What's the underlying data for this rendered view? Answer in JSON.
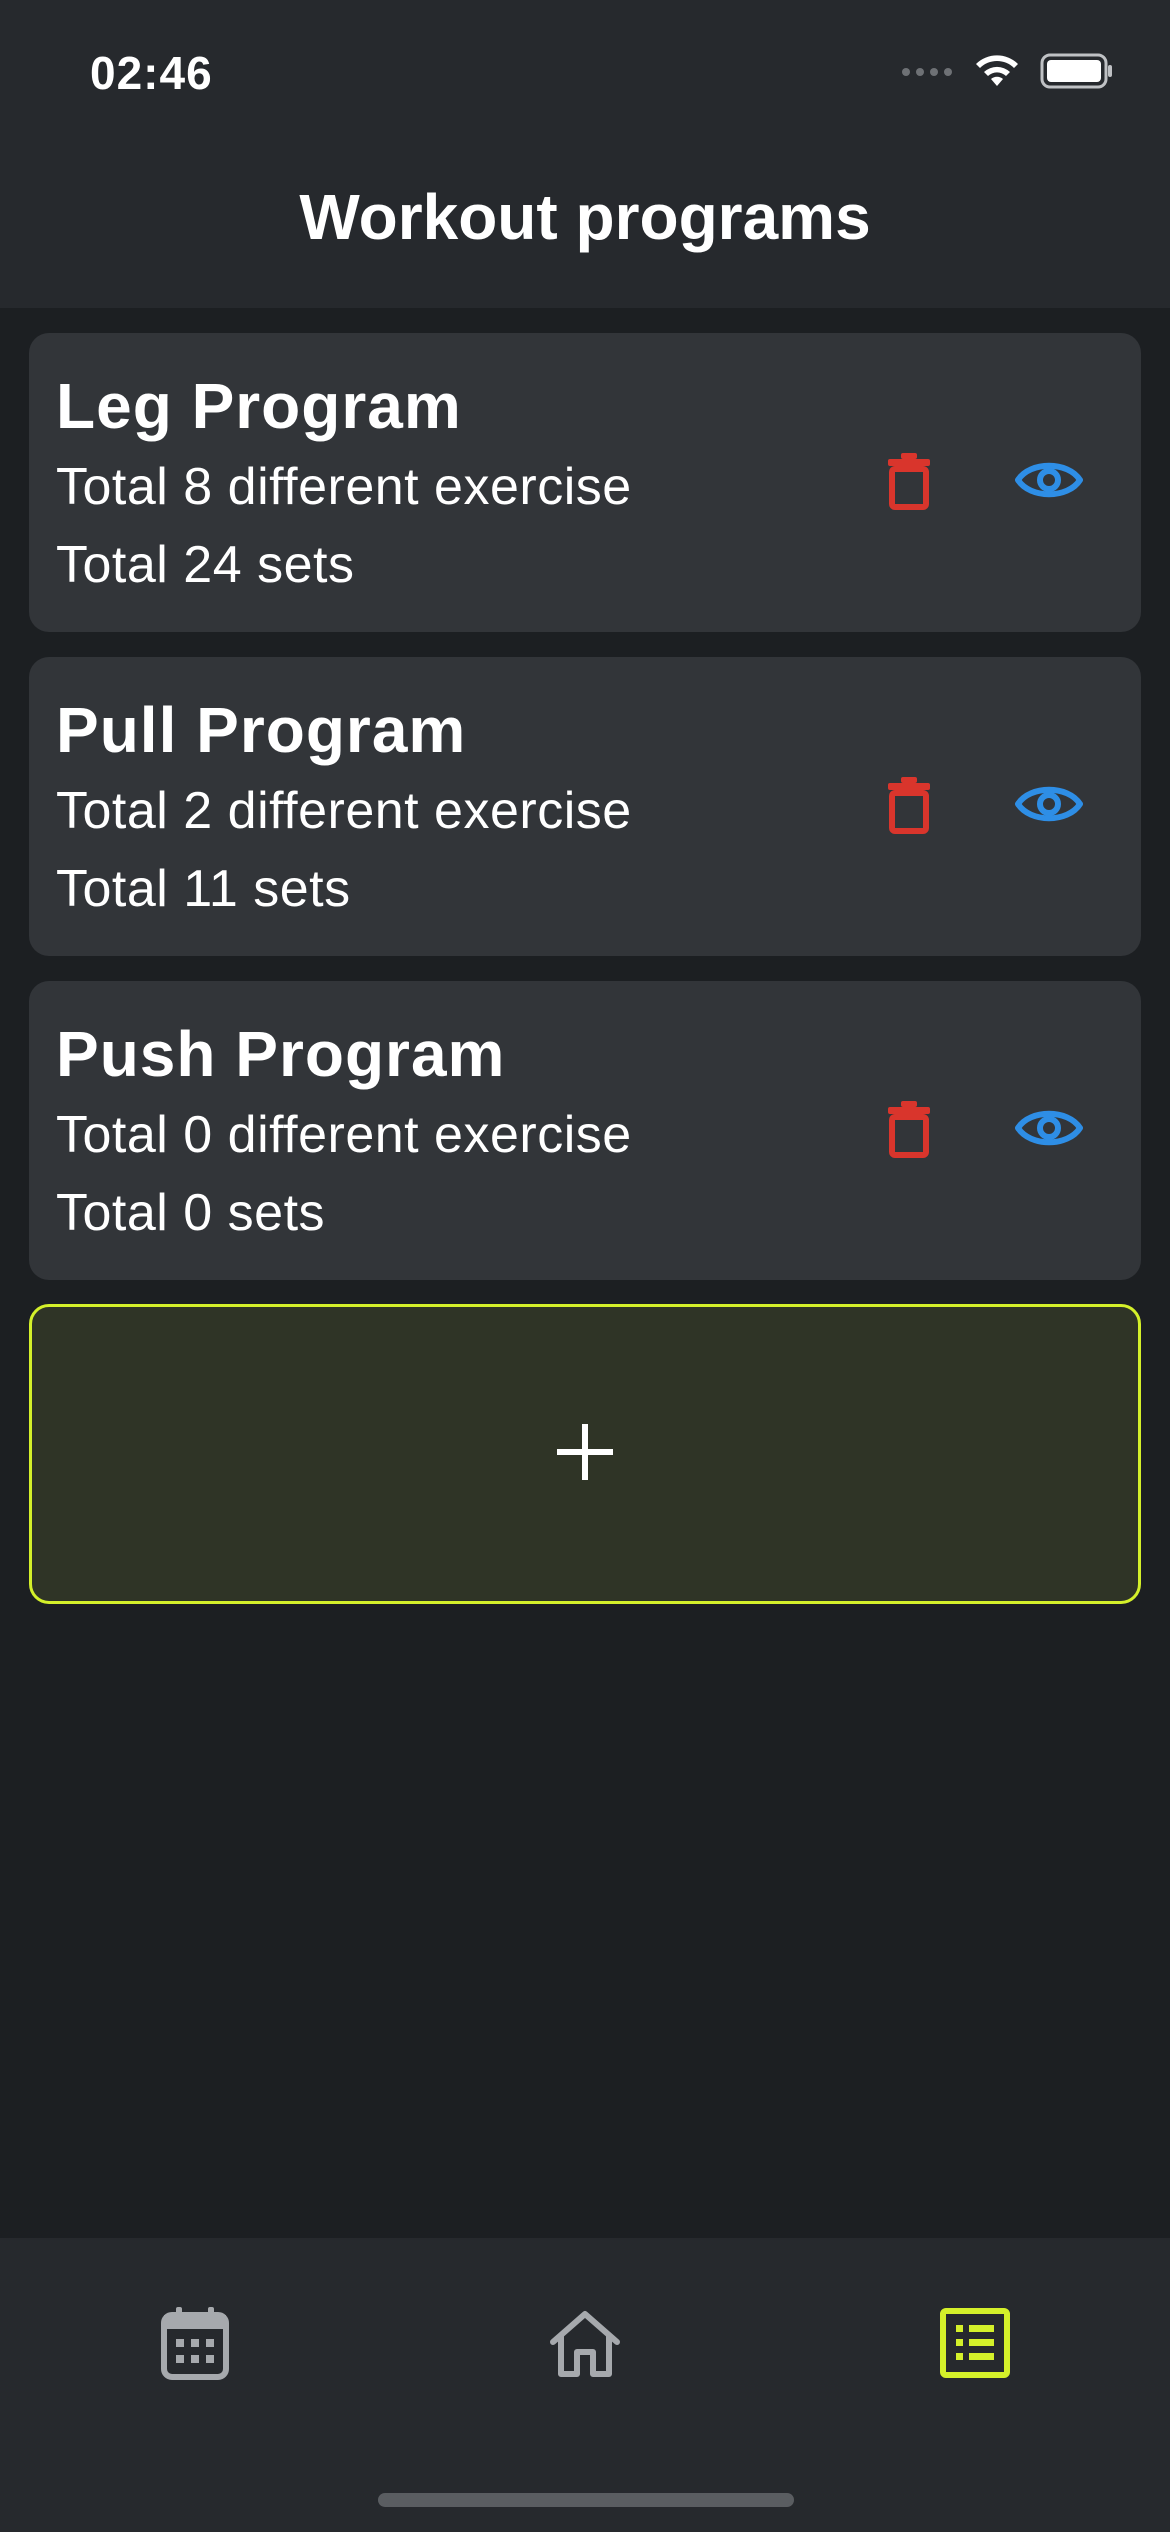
{
  "status_bar": {
    "time": "02:46"
  },
  "header": {
    "title": "Workout programs"
  },
  "programs": [
    {
      "name": "Leg Program",
      "exercises": "Total 8 different exercise",
      "sets": "Total 24 sets"
    },
    {
      "name": "Pull Program",
      "exercises": "Total 2 different exercise",
      "sets": "Total 11 sets"
    },
    {
      "name": "Push Program",
      "exercises": "Total 0 different exercise",
      "sets": "Total 0 sets"
    }
  ],
  "add_button": {
    "label": "+"
  },
  "bottom_nav": {
    "items": [
      {
        "icon": "calendar-icon",
        "active": false
      },
      {
        "icon": "home-icon",
        "active": false
      },
      {
        "icon": "list-icon",
        "active": true
      }
    ]
  },
  "colors": {
    "accent": "#d4f02a",
    "delete": "#d9352c",
    "view": "#2e8ee6",
    "card_bg": "#323539",
    "background": "#1c1f22"
  }
}
